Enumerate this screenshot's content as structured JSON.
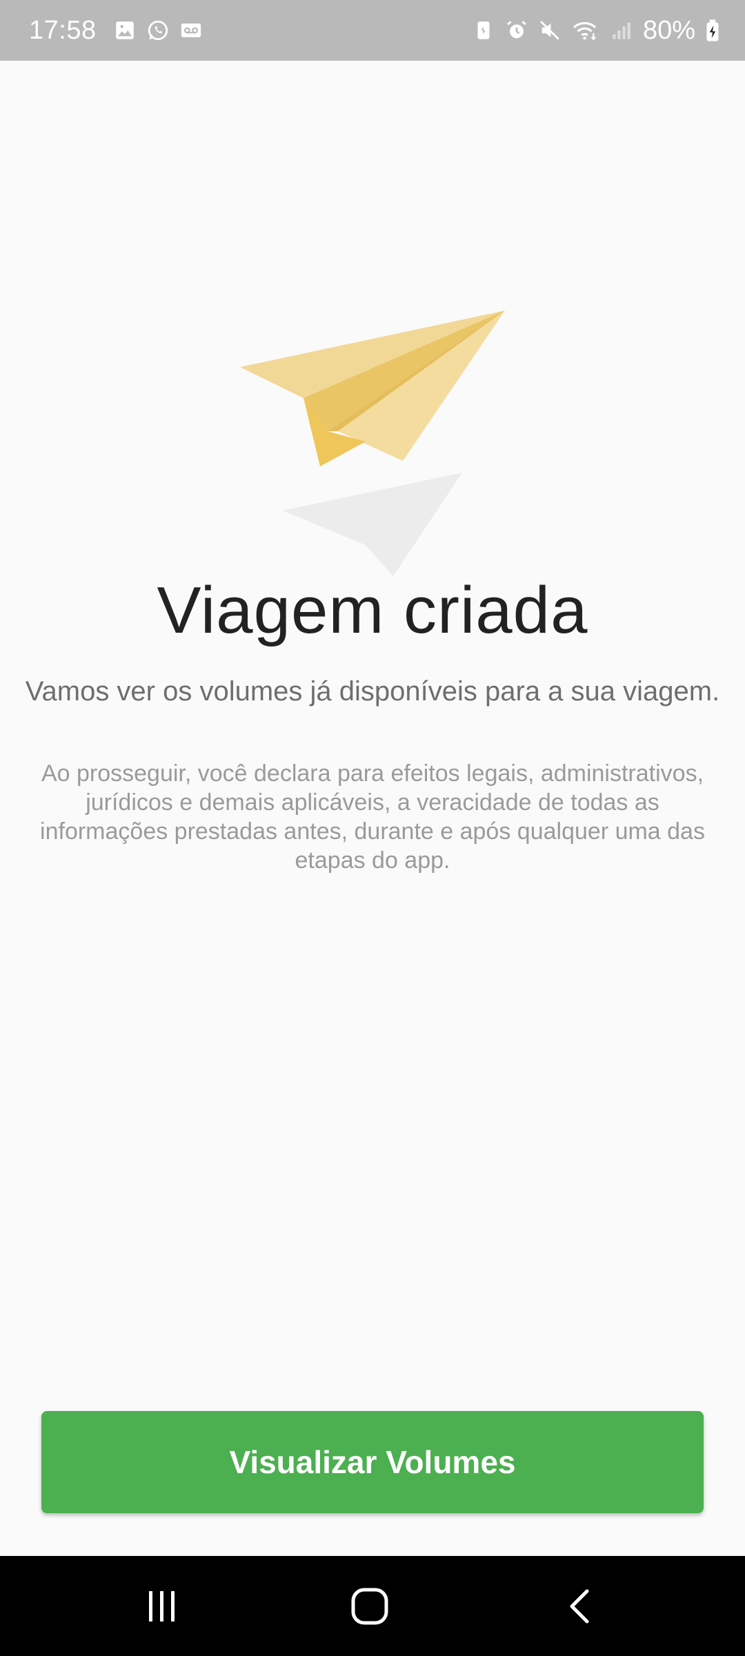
{
  "status_bar": {
    "time": "17:58",
    "battery_percent": "80%",
    "left_icons": [
      "gallery-icon",
      "whatsapp-icon",
      "voicemail-icon"
    ],
    "right_icons": [
      "battery-saver-icon",
      "alarm-icon",
      "mute-icon",
      "wifi-icon",
      "signal-icon",
      "battery-charging-icon"
    ]
  },
  "main": {
    "title": "Viagem criada",
    "subtitle": "Vamos ver os volumes já disponíveis para a sua viagem.",
    "disclaimer": "Ao prosseguir, você declara para efeitos legais, administrativos, jurídicos e demais aplicáveis, a veracidade de todas as informações prestadas antes, durante e após qualquer uma das etapas do app.",
    "illustration": "paper-plane-icon"
  },
  "actions": {
    "primary_label": "Visualizar Volumes"
  },
  "nav_bar": {
    "items": [
      "recent-apps-icon",
      "home-icon",
      "back-icon"
    ]
  },
  "colors": {
    "accent": "#4caf50",
    "status_bar": "#b9b9b9",
    "plane": "#f2d896",
    "background": "#fafafa"
  }
}
